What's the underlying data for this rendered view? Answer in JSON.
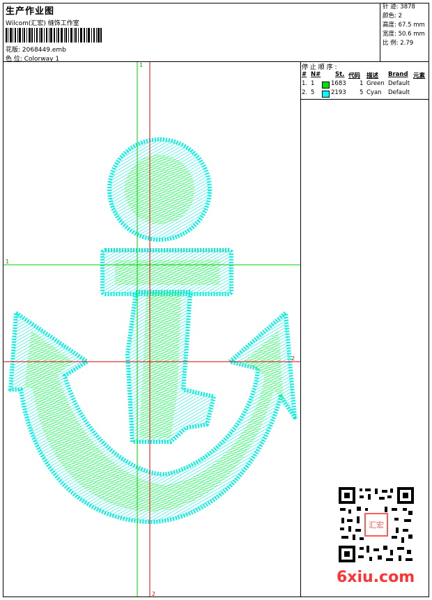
{
  "header": {
    "title": "生产作业图",
    "company": "Wilcom(汇宏) 缝饰工作室",
    "design_label": "花版: 2068449.emb",
    "colorway_label": "色 位:  Colorway 1"
  },
  "stats": [
    {
      "label": "针 迹:",
      "value": "3878"
    },
    {
      "label": "颜色:",
      "value": "2"
    },
    {
      "label": "高度:",
      "value": "67.5 mm"
    },
    {
      "label": "宽度:",
      "value": "50.6 mm"
    },
    {
      "label": "比 例:",
      "value": "2.79"
    }
  ],
  "stop_sequence": {
    "title": "停 止 顺 序 :",
    "headers": {
      "n": "#",
      "no": "N#",
      "st": "St.",
      "code": "代码",
      "desc": "描述",
      "brand": "Brand",
      "element": "元素"
    },
    "rows": [
      {
        "n": "1.",
        "no": "1",
        "color": "#00e000",
        "st": "1683",
        "code": "1",
        "desc": "Green",
        "brand": "Default"
      },
      {
        "n": "2.",
        "no": "5",
        "color": "#00ffff",
        "st": "2193",
        "code": "5",
        "desc": "Cyan",
        "brand": "Default"
      }
    ]
  },
  "guides": {
    "h1": "1",
    "h2": "2",
    "v1": "1",
    "v2": "2"
  },
  "colors": {
    "green": "#00e000",
    "cyan": "#00f0e0",
    "guide_green": "#00cc00",
    "guide_red": "#dd0000"
  },
  "stamp_text": "汇宏",
  "watermark": "6xiu.com"
}
